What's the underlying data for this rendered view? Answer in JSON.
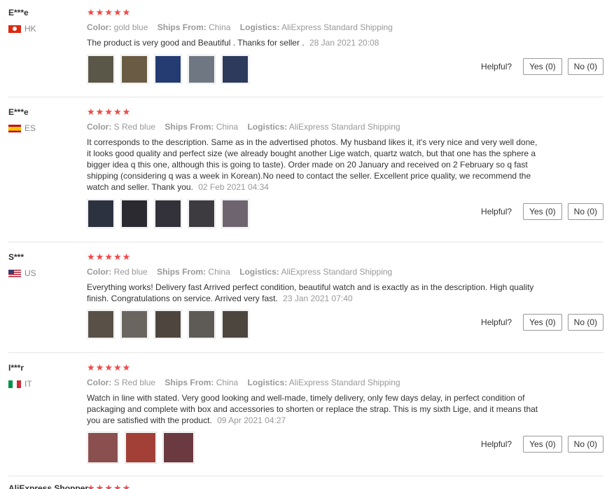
{
  "labels": {
    "color": "Color:",
    "ships_from": "Ships From:",
    "logistics": "Logistics:",
    "helpful": "Helpful?"
  },
  "reviews": [
    {
      "user": "E***e",
      "country": "HK",
      "rating": 4.5,
      "color": "gold blue",
      "ships_from": "China",
      "logistics": "AliExpress Standard Shipping",
      "text": "The product is very good and Beautiful . Thanks for seller .",
      "date": "28 Jan 2021 20:08",
      "yes": "Yes (0)",
      "no": "No (0)",
      "photo_colors": [
        "#5a5648",
        "#6a5c44",
        "#243c72",
        "#6f7782",
        "#2d3a5c"
      ]
    },
    {
      "user": "E***e",
      "country": "ES",
      "rating": 5,
      "color": "S Red blue",
      "ships_from": "China",
      "logistics": "AliExpress Standard Shipping",
      "text": "It corresponds to the description. Same as in the advertised photos. My husband likes it, it's very nice and very well done, it looks good quality and perfect size (we already bought another Lige watch, quartz watch, but that one has the sphere a bigger idea q this one, although this is going to taste). Order made on 20 January and received on 2 February so q fast shipping (considering q was a week in Korean).No need to contact the seller. Excellent price quality, we recommend the watch and seller. Thank you.",
      "date": "02 Feb 2021 04:34",
      "yes": "Yes (0)",
      "no": "No (0)",
      "photo_colors": [
        "#2c3240",
        "#2a2a30",
        "#33323a",
        "#3d3b40",
        "#6e6470"
      ]
    },
    {
      "user": "S***",
      "country": "US",
      "rating": 4.5,
      "color": "Red blue",
      "ships_from": "China",
      "logistics": "AliExpress Standard Shipping",
      "text": "Everything works! Delivery fast Arrived perfect condition, beautiful watch and is exactly as in the description. High quality finish. Congratulations on service. Arrived very fast.",
      "date": "23 Jan 2021 07:40",
      "yes": "Yes (0)",
      "no": "No (0)",
      "photo_colors": [
        "#595048",
        "#6b6560",
        "#4e463e",
        "#5e5a56",
        "#4c463f"
      ]
    },
    {
      "user": "I***r",
      "country": "IT",
      "rating": 5,
      "color": "S Red blue",
      "ships_from": "China",
      "logistics": "AliExpress Standard Shipping",
      "text": "Watch in line with stated. Very good looking and well-made, timely delivery, only few days delay, in perfect condition of packaging and complete with box and accessories to shorten or replace the strap. This is my sixth Lige, and it means that you are satisfied with the product.",
      "date": "09 Apr 2021 04:27",
      "yes": "Yes (0)",
      "no": "No (0)",
      "photo_colors": [
        "#8a5050",
        "#a24038",
        "#6a3a40"
      ]
    }
  ],
  "next_review": {
    "user": "AliExpress Shopper",
    "rating": 5
  },
  "colors": {
    "star": "#f04848",
    "muted": "#999999",
    "text": "#333333",
    "divider": "#e6e6e6"
  }
}
